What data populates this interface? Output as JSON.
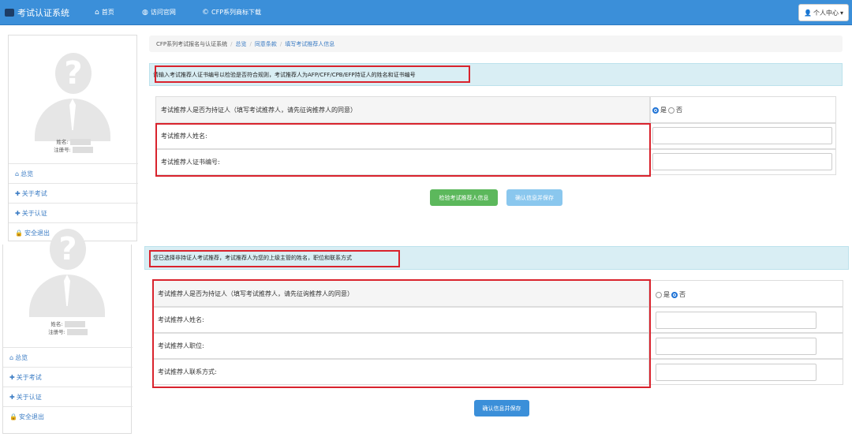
{
  "nav": {
    "brand": "考试认证系统",
    "home": "首页",
    "website": "访问官网",
    "cfp_download": "CFP系列商标下载",
    "user_center": "个人中心"
  },
  "sidebar": {
    "name_label": "姓名:",
    "reg_label": "注册号:",
    "items": [
      "总览",
      "关于考试",
      "关于认证",
      "安全退出"
    ]
  },
  "breadcrumb": [
    "CFP系列考试报名与认证系统",
    "总览",
    "同意条款",
    "填写考试推荐人信息"
  ],
  "section1": {
    "alert": "请输入考试推荐人证书编号以检验是否符合规则，考试推荐人为AFP/CFF/CPB/EFP持证人的姓名和证书编号",
    "question": "考试推荐人是否为持证人（填写考试推荐人，请先征询推荐人的同意）",
    "yes": "是",
    "no": "否",
    "name_label": "考试推荐人姓名:",
    "cert_label": "考试推荐人证书编号:",
    "check_button": "检验考试推荐人信息",
    "save_button": "确认信息并保存"
  },
  "section2": {
    "alert": "您已选择非持证人考试推荐，考试推荐人为您的上级主管的姓名，职位和联系方式",
    "question": "考试推荐人是否为持证人（填写考试推荐人，请先征询推荐人的同意）",
    "yes": "是",
    "no": "否",
    "name_label": "考试推荐人姓名:",
    "position_label": "考试推荐人职位:",
    "contact_label": "考试推荐人联系方式:",
    "save_button": "确认信息并保存"
  },
  "colors": {
    "navbar": "#3b8fd9",
    "alert_bg": "#d9eef4",
    "highlight": "#d9232d",
    "check_button": "#5cb85c"
  },
  "icons": {
    "brand": "graduation-cap-icon",
    "home": "home-icon",
    "website": "globe-icon",
    "cfp": "copyright-icon",
    "user": "user-icon",
    "overview": "home-icon",
    "exam": "plus-icon",
    "cert": "plus-icon",
    "logout": "lock-icon"
  }
}
